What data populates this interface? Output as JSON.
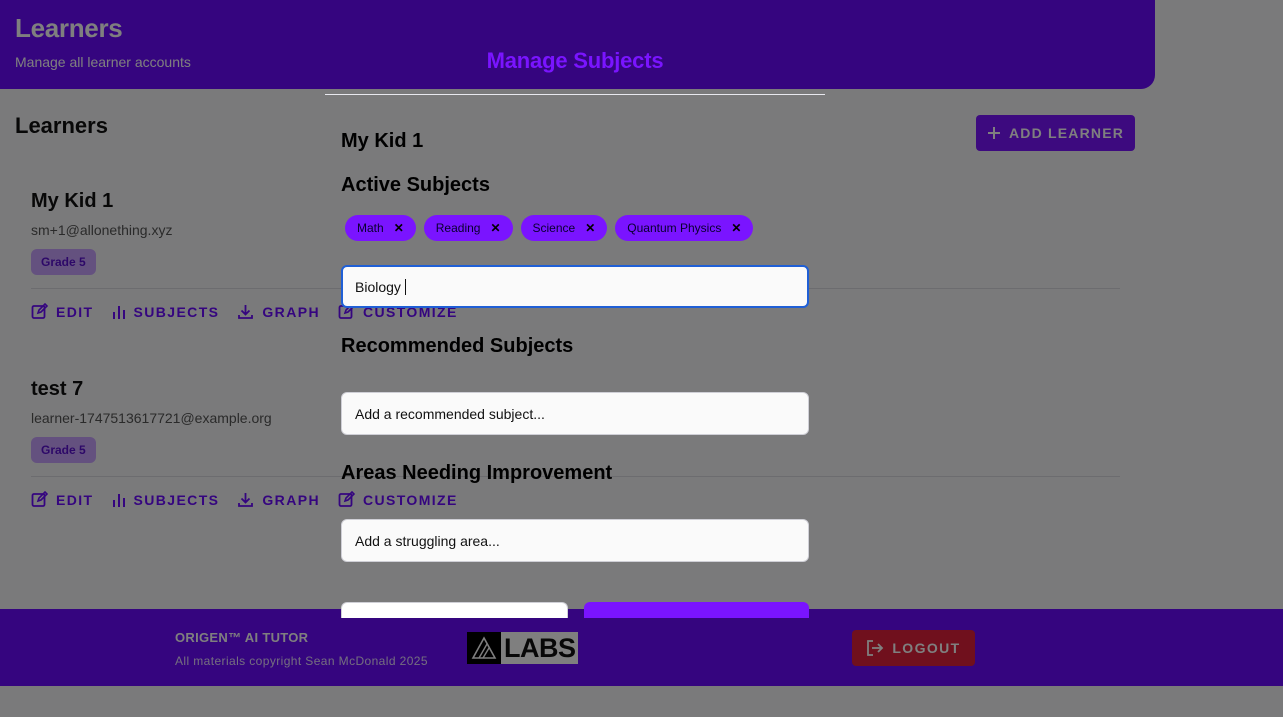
{
  "header": {
    "title": "Learners",
    "subtitle": "Manage all learner accounts"
  },
  "section": {
    "title": "Learners",
    "add_button_label": "ADD LEARNER"
  },
  "learners": [
    {
      "name": "My Kid 1",
      "email": "sm+1@allonething.xyz",
      "grade": "Grade 5"
    },
    {
      "name": "test 7",
      "email": "learner-1747513617721@example.org",
      "grade": "Grade 5"
    }
  ],
  "card_actions": {
    "edit": "EDIT",
    "subjects": "SUBJECTS",
    "graph": "GRAPH",
    "customize": "CUSTOMIZE"
  },
  "footer": {
    "brand": "ORIGEN™ AI TUTOR",
    "copyright": "All materials copyright Sean McDonald 2025",
    "logo_text": "LABS",
    "logout_label": "LOGOUT"
  },
  "modal": {
    "title": "Manage Subjects",
    "learner_name": "My Kid 1",
    "active_heading": "Active Subjects",
    "active_subjects": [
      "Math",
      "Reading",
      "Science",
      "Quantum Physics"
    ],
    "subject_input_value": "Biology",
    "recommended_heading": "Recommended Subjects",
    "recommended_placeholder": "Add a recommended subject...",
    "improvement_heading": "Areas Needing Improvement",
    "struggling_placeholder": "Add a struggling area..."
  },
  "colors": {
    "brand_purple": "#6a0bff",
    "chip_purple": "#7a14ff",
    "logout_red": "#e0203a",
    "focus_blue": "#1f5fd6"
  }
}
